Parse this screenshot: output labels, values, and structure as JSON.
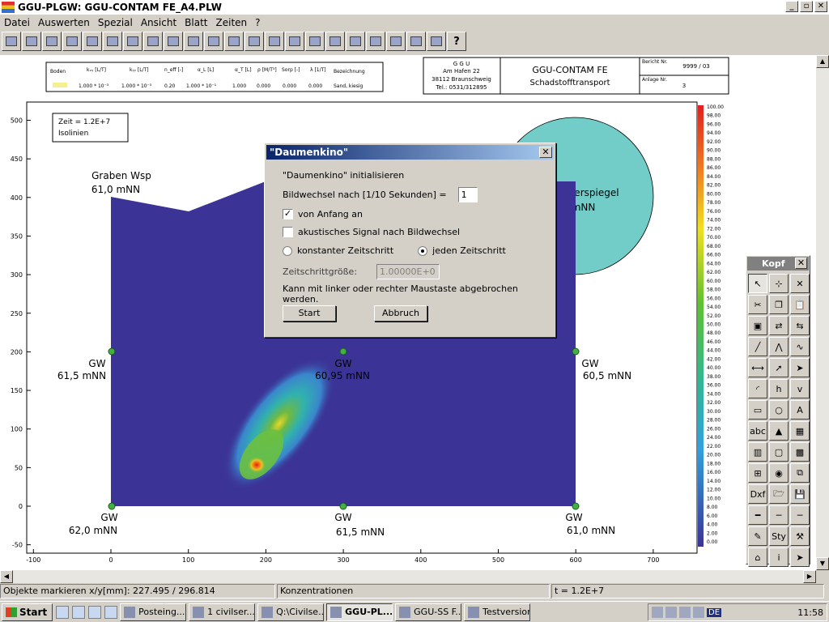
{
  "window": {
    "title": "GGU-PLGW: GGU-CONTAM FE_A4.PLW"
  },
  "menu": [
    "Datei",
    "Auswerten",
    "Spezial",
    "Ansicht",
    "Blatt",
    "Zeiten",
    "?"
  ],
  "toolbar": {
    "icons": [
      "open-icon",
      "save-icon",
      "print-icon",
      "tools-icon",
      "zoom-icon",
      "draw-icon",
      "fill-icon",
      "copy-icon",
      "pages-icon",
      "polygon-icon",
      "isoline-icon",
      "isoline-color-icon",
      "iso-icon",
      "color-icon",
      "timer-icon",
      "section-icon",
      "cut-icon",
      "graph-icon",
      "gate-icon",
      "double-arrow-icon",
      "arrow-down-icon",
      "arrow-up-icon",
      "help-icon"
    ],
    "help_label": "?"
  },
  "legend_table": {
    "headers": [
      "Boden",
      "kₓᵧ [L/T]",
      "kᵧᵧ [L/T]",
      "n_eff [-]",
      "α_L [L]",
      "α_T [L]",
      "ρ [M/T³]",
      "Sorp [-]",
      "λ [1/T]",
      "Bezeichnung"
    ],
    "row": [
      "",
      "1.000 * 10⁻³",
      "1.000 * 10⁻³",
      "0.20",
      "1.000 * 10⁻¹",
      "1.000",
      "0.000",
      "0.000",
      "0.000",
      "Sand, kiesig"
    ],
    "soil_color": "#f4f090"
  },
  "info_box": {
    "org": "G G U",
    "street": "Am Hafen 22",
    "city": "38112 Braunschweig",
    "tel": "Tel.: 0531/312895",
    "title": "GGU-CONTAM FE",
    "subtitle": "Schadstofftransport",
    "bericht_label": "Bericht Nr.",
    "bericht_value": "9999 / 03",
    "anlage_label": "Anlage Nr.",
    "anlage_value": "3"
  },
  "plot": {
    "time_line": "Zeit = 1.2E+7",
    "iso_line": "Isolinien",
    "x_ticks": [
      "-100",
      "0",
      "100",
      "200",
      "300",
      "400",
      "500",
      "600",
      "700"
    ],
    "y_ticks": [
      "500",
      "450",
      "400",
      "350",
      "300",
      "250",
      "200",
      "150",
      "100",
      "50",
      "0",
      "-50"
    ],
    "colors": {
      "domain": "#3b3496",
      "circle": "#72ccc8",
      "node": "#44b044"
    },
    "labels": [
      {
        "id": "graben",
        "line1": "Graben Wsp",
        "line2": "61,0 mNN"
      },
      {
        "id": "gw-left-mid",
        "line1": "GW",
        "line2": "61,5 mNN"
      },
      {
        "id": "gw-center-mid",
        "line1": "GW",
        "line2": "60,95 mNN"
      },
      {
        "id": "gw-right-mid",
        "line1": "GW",
        "line2": "60,5 mNN"
      },
      {
        "id": "gw-left-bottom",
        "line1": "GW",
        "line2": "62,0 mNN"
      },
      {
        "id": "gw-center-bottom",
        "line1": "GW",
        "line2": "61,5 mNN"
      },
      {
        "id": "gw-right-bottom",
        "line1": "GW",
        "line2": "61,0 mNN"
      }
    ],
    "wasserspiegel_line1": "asserspiegel",
    "wasserspiegel_line2": "60 mNN",
    "colorbar": [
      "100.00",
      "98.00",
      "96.00",
      "94.00",
      "92.00",
      "90.00",
      "88.00",
      "86.00",
      "84.00",
      "82.00",
      "80.00",
      "78.00",
      "76.00",
      "74.00",
      "72.00",
      "70.00",
      "68.00",
      "66.00",
      "64.00",
      "62.00",
      "60.00",
      "58.00",
      "56.00",
      "54.00",
      "52.00",
      "50.00",
      "48.00",
      "46.00",
      "44.00",
      "42.00",
      "40.00",
      "38.00",
      "36.00",
      "34.00",
      "32.00",
      "30.00",
      "28.00",
      "26.00",
      "24.00",
      "22.00",
      "20.00",
      "18.00",
      "16.00",
      "14.00",
      "12.00",
      "10.00",
      "8.00",
      "6.00",
      "4.00",
      "2.00",
      "0.00"
    ]
  },
  "dialog": {
    "title": "\"Daumenkino\"",
    "close": "✕",
    "init_text": "\"Daumenkino\" initialisieren",
    "bildwechsel_label": "Bildwechsel nach [1/10 Sekunden] =",
    "bildwechsel_value": "1",
    "von_anfang_label": "von Anfang an",
    "von_anfang_checked": true,
    "akustisch_label": "akustisches Signal nach Bildwechsel",
    "akustisch_checked": false,
    "konstant_label": "konstanter Zeitschritt",
    "jeden_label": "jeden Zeitschritt",
    "selected_mode": "jeden",
    "zeitschritt_label": "Zeitschrittgröße:",
    "zeitschritt_value": "1.00000E+0",
    "hint": "Kann mit linker oder rechter Maustaste abgebrochen werden.",
    "start_label": "Start",
    "abbruch_label": "Abbruch"
  },
  "palette": {
    "title": "Kopf",
    "close": "✕",
    "buttons": [
      {
        "name": "pointer-icon",
        "glyph": "↖"
      },
      {
        "name": "node-pointer-icon",
        "glyph": "⊹"
      },
      {
        "name": "delete-icon",
        "glyph": "✕"
      },
      {
        "name": "cut-icon",
        "glyph": "✂"
      },
      {
        "name": "copy-icon",
        "glyph": "❐"
      },
      {
        "name": "paste-icon",
        "glyph": "📋"
      },
      {
        "name": "image-icon",
        "glyph": "▣"
      },
      {
        "name": "link-icon",
        "glyph": "⇄"
      },
      {
        "name": "unlink-icon",
        "glyph": "⇆"
      },
      {
        "name": "line-icon",
        "glyph": "╱"
      },
      {
        "name": "polyline-icon",
        "glyph": "⋀"
      },
      {
        "name": "freehand-icon",
        "glyph": "∿"
      },
      {
        "name": "dimension-icon",
        "glyph": "⟷"
      },
      {
        "name": "arrow-line-icon",
        "glyph": "➚"
      },
      {
        "name": "arrow-fill-icon",
        "glyph": "➤"
      },
      {
        "name": "arc-icon",
        "glyph": "◜"
      },
      {
        "name": "hline-icon",
        "glyph": "h"
      },
      {
        "name": "vline-icon",
        "glyph": "v"
      },
      {
        "name": "rectangle-icon",
        "glyph": "▭"
      },
      {
        "name": "circle-icon",
        "glyph": "○"
      },
      {
        "name": "text-icon",
        "glyph": "A"
      },
      {
        "name": "textbox-icon",
        "glyph": "abc"
      },
      {
        "name": "picture-icon",
        "glyph": "▲"
      },
      {
        "name": "table-icon",
        "glyph": "▦"
      },
      {
        "name": "books-icon",
        "glyph": "▥"
      },
      {
        "name": "frame-icon",
        "glyph": "▢"
      },
      {
        "name": "grid-icon",
        "glyph": "▩"
      },
      {
        "name": "import-icon",
        "glyph": "⊞"
      },
      {
        "name": "target-icon",
        "glyph": "◉"
      },
      {
        "name": "layers-icon",
        "glyph": "⧉"
      },
      {
        "name": "dxf-icon",
        "glyph": "Dxf"
      },
      {
        "name": "open-folder-icon",
        "glyph": "🗁"
      },
      {
        "name": "save-icon",
        "glyph": "💾"
      },
      {
        "name": "thick-line-icon",
        "glyph": "━"
      },
      {
        "name": "medium-line-icon",
        "glyph": "─"
      },
      {
        "name": "thin-line-icon",
        "glyph": "─"
      },
      {
        "name": "pen-icon",
        "glyph": "✎"
      },
      {
        "name": "style-icon",
        "glyph": "Sty"
      },
      {
        "name": "wrench-icon",
        "glyph": "⚒"
      },
      {
        "name": "home-icon",
        "glyph": "⌂"
      },
      {
        "name": "info-icon",
        "glyph": "i"
      },
      {
        "name": "cursor-icon",
        "glyph": "➤"
      }
    ]
  },
  "status": {
    "objekte": "Objekte markieren  x/y[mm]: 227.495 / 296.814",
    "mode": "Konzentrationen",
    "time": "t =  1.2E+7"
  },
  "taskbar": {
    "start_label": "Start",
    "tasks": [
      {
        "label": "Posteing...",
        "active": false
      },
      {
        "label": "1 civilser...",
        "active": false
      },
      {
        "label": "Q:\\Civilse...",
        "active": false
      },
      {
        "label": "GGU-PL...",
        "active": true
      },
      {
        "label": "GGU-SS F...",
        "active": false
      },
      {
        "label": "Testversion",
        "active": false
      }
    ],
    "lang": "DE",
    "clock": "11:58"
  }
}
